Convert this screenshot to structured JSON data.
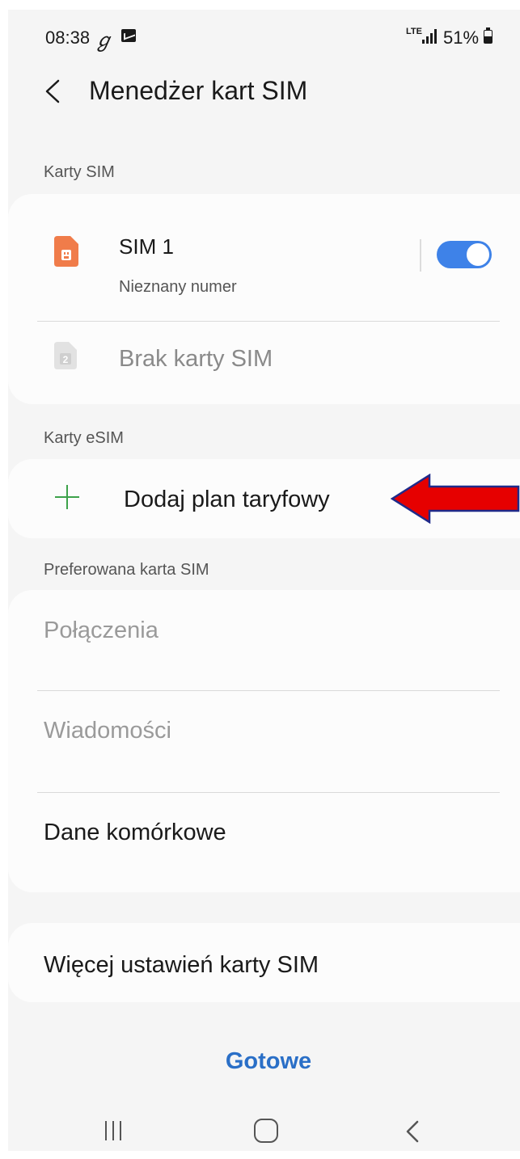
{
  "status_bar": {
    "time": "08:38",
    "g_icon": "g-pay-icon",
    "message_icon": "message-icon",
    "network_label": "LTE",
    "battery_percent": "51%"
  },
  "header": {
    "title": "Menedżer kart SIM",
    "back_icon": "chevron-left-icon"
  },
  "sim_cards": {
    "section_title": "Karty SIM",
    "sim1": {
      "name": "SIM 1",
      "subtitle": "Nieznany numer",
      "enabled": true,
      "icon_color": "#f07c4a"
    },
    "sim2": {
      "icon_digit": "2",
      "label": "Brak karty SIM"
    }
  },
  "esim": {
    "section_title": "Karty eSIM",
    "add_plan_label": "Dodaj plan taryfowy",
    "plus_color": "#3da24a"
  },
  "preferred_sim": {
    "section_title": "Preferowana karta SIM",
    "calls_label": "Połączenia",
    "messages_label": "Wiadomości",
    "mobile_data_label": "Dane komórkowe"
  },
  "more_settings": {
    "label": "Więcej ustawień karty SIM"
  },
  "footer": {
    "done_label": "Gotowe",
    "accent_color": "#2a6fc7"
  },
  "annotation": {
    "arrow_color": "#e60000"
  }
}
